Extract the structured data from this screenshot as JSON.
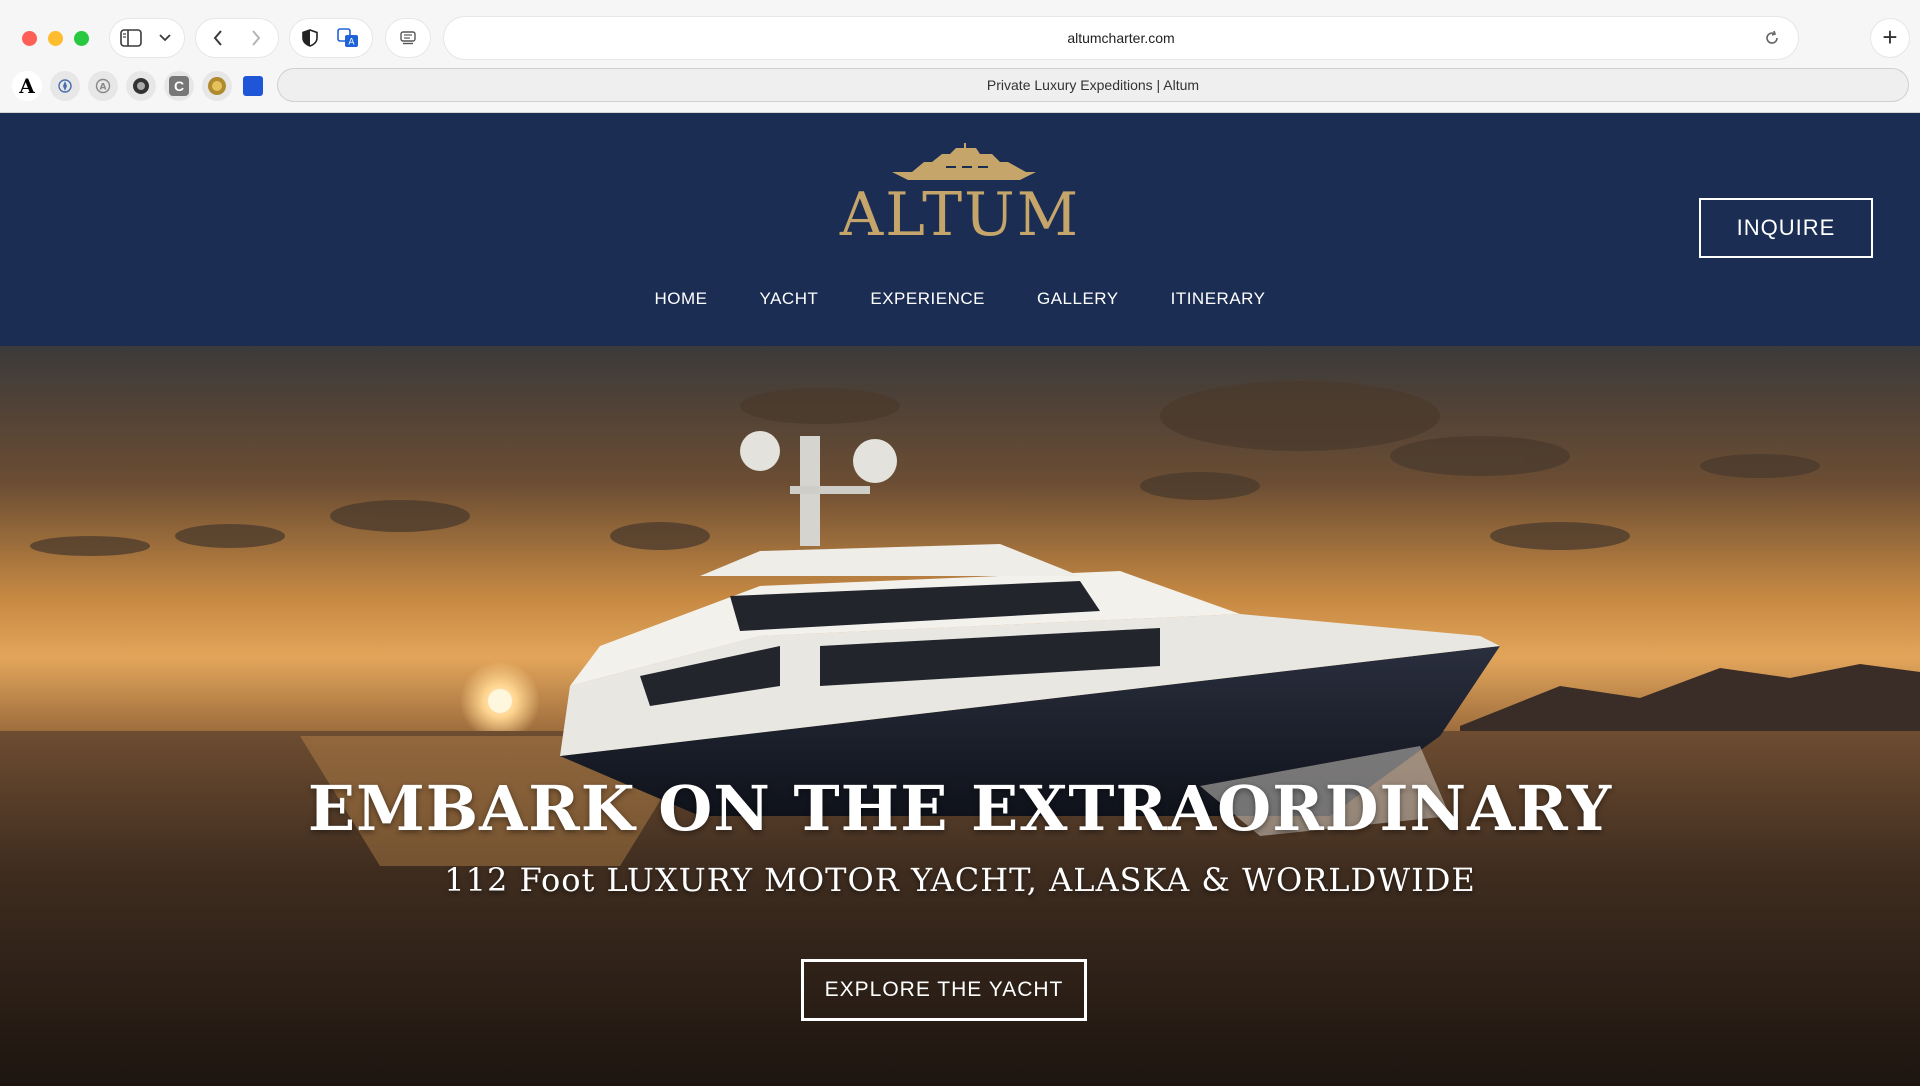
{
  "browser": {
    "url": "altumcharter.com",
    "tab_title": "Private Luxury Expeditions  |  Altum",
    "new_tab_label": "+",
    "favorites": [
      "A",
      "",
      "",
      "",
      "C",
      "",
      ""
    ]
  },
  "site": {
    "logo_text": "ALTUM",
    "inquire_label": "INQUIRE",
    "menu": [
      "HOME",
      "YACHT",
      "EXPERIENCE",
      "GALLERY",
      "ITINERARY"
    ]
  },
  "hero": {
    "title": "EMBARK ON THE EXTRAORDINARY",
    "subtitle": "112 Foot LUXURY MOTOR YACHT, ALASKA & WORLDWIDE",
    "cta_label": "EXPLORE THE YACHT"
  },
  "colors": {
    "header_bg": "#1b2d52",
    "logo_gold": "#c5a56a",
    "button_border": "#ffffff"
  },
  "icons": [
    "sidebar-icon",
    "chevron-down-icon",
    "back-icon",
    "forward-icon",
    "shield-icon",
    "translate-icon",
    "reader-icon",
    "reload-icon",
    "yacht-logo-icon"
  ]
}
